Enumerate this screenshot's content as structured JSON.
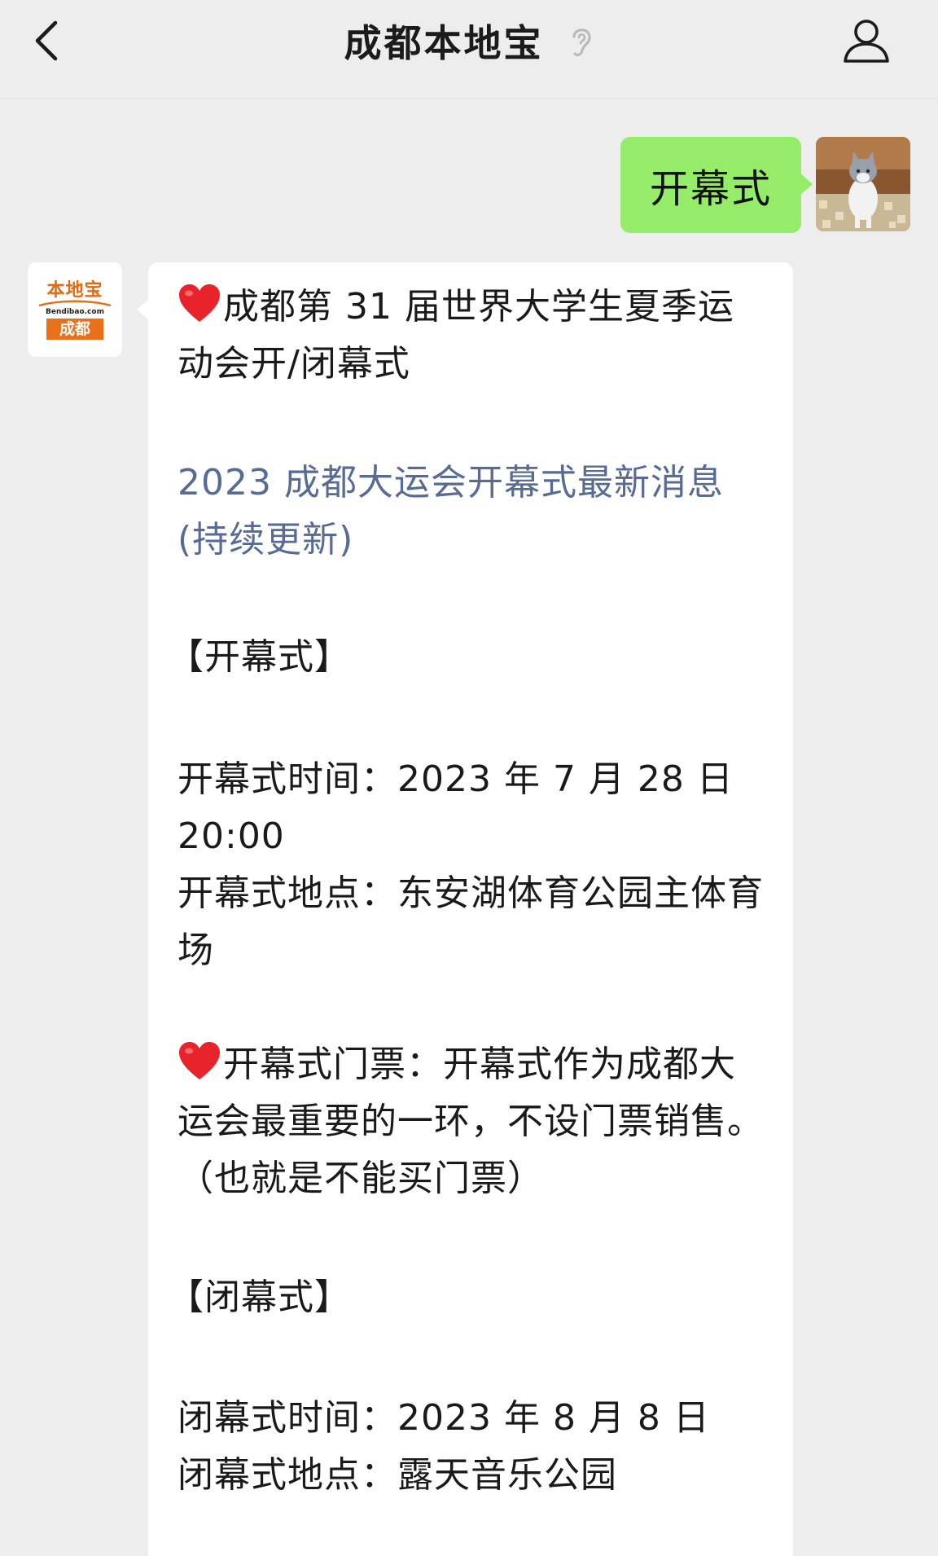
{
  "header": {
    "title": "成都本地宝",
    "back_icon": "chevron-left-icon",
    "ear_icon": "ear-icon",
    "profile_icon": "person-icon"
  },
  "outgoing": {
    "text": "开幕式",
    "bubble_color": "#95ec69"
  },
  "bot": {
    "logo_top": "本地宝",
    "logo_url": "Bendibao.com",
    "logo_city": "成都"
  },
  "reply": {
    "heading": "成都第 31 届世界大学生夏季运动会开/闭幕式",
    "link": "2023 成都大运会开幕式最新消息(持续更新)",
    "link_color": "#576b95",
    "section_open": "【开幕式】",
    "open_time": "开幕式时间：2023 年 7 月 28 日 20:00",
    "open_place": "开幕式地点：东安湖体育公园主体育场",
    "ticket": "开幕式门票：开幕式作为成都大运会最重要的一环，不设门票销售。（也就是不能买门票）",
    "section_close": "【闭幕式】",
    "close_time": "闭幕式时间：2023 年 8 月 8 日",
    "close_place": "闭幕式地点：露天音乐公园"
  }
}
